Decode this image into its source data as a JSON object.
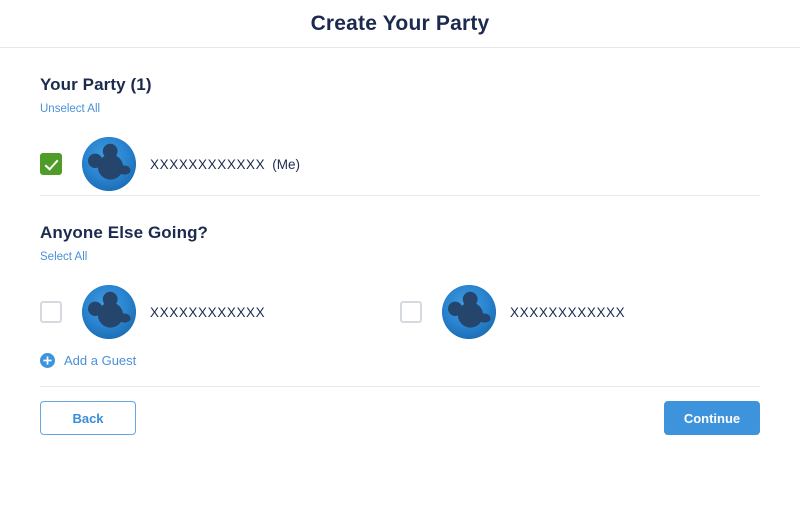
{
  "header": {
    "title": "Create Your Party"
  },
  "party_section": {
    "title": "Your Party (1)",
    "toggle_link": "Unselect All",
    "members": [
      {
        "name": "XXXXXXXXXXXX",
        "suffix": "(Me)",
        "checked": true,
        "avatar": "mickey-avatar"
      }
    ]
  },
  "others_section": {
    "title": "Anyone Else Going?",
    "toggle_link": "Select All",
    "members": [
      {
        "name": "XXXXXXXXXXXX",
        "suffix": "",
        "checked": false,
        "avatar": "mickey-avatar"
      },
      {
        "name": "XXXXXXXXXXXX",
        "suffix": "",
        "checked": false,
        "avatar": "mickey-avatar"
      }
    ],
    "add_guest_label": "Add a Guest",
    "add_guest_icon": "plus-circle-icon"
  },
  "footer": {
    "back_label": "Back",
    "continue_label": "Continue"
  },
  "colors": {
    "title_navy": "#1b2a4e",
    "link_blue": "#4a90d9",
    "primary_blue": "#3d94dd",
    "checked_green": "#4f9c28",
    "checkbox_border": "#d5d9e0",
    "avatar_blue": "#2a84d0",
    "avatar_silhouette": "#24446b",
    "divider": "#e8eaee"
  }
}
